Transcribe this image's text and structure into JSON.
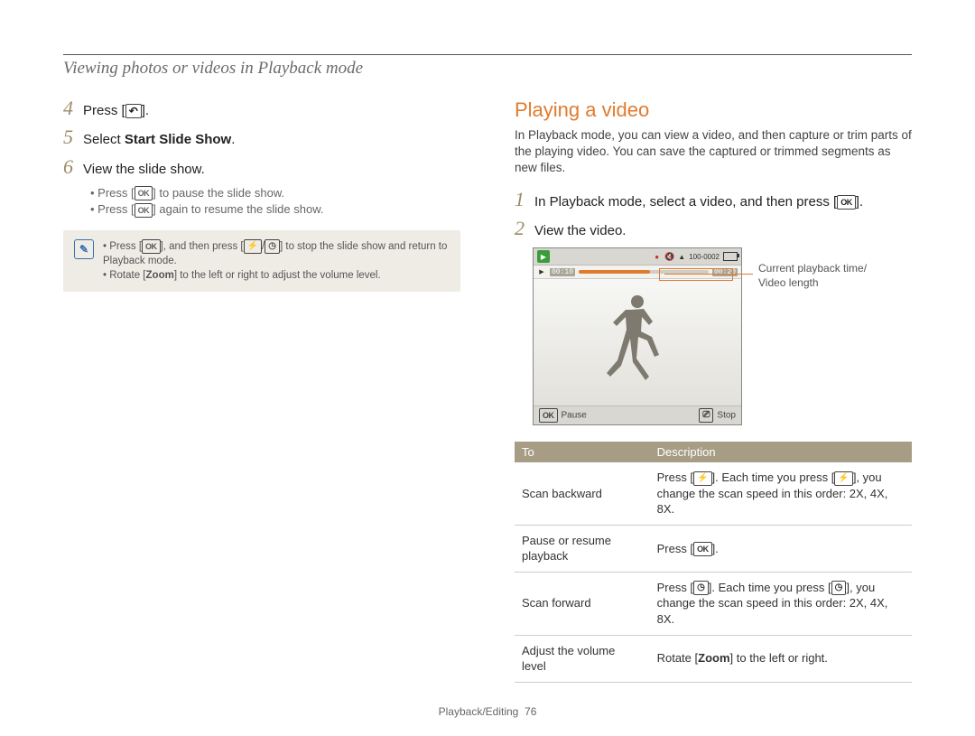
{
  "page_heading": "Viewing photos or videos in Playback mode",
  "left": {
    "steps": [
      {
        "num": "4",
        "pre": "Press [",
        "icon": "back",
        "post": "]."
      },
      {
        "num": "5",
        "pre": "Select ",
        "bold": "Start Slide Show",
        "post": "."
      },
      {
        "num": "6",
        "text": "View the slide show."
      }
    ],
    "subbullets": [
      {
        "pre": "Press [",
        "icon": "ok",
        "post": "] to pause the slide show."
      },
      {
        "pre": "Press [",
        "icon": "ok",
        "post": "] again to resume the slide show."
      }
    ],
    "note": [
      {
        "pre": "Press [",
        "icon": "ok",
        "mid": "], and then press [",
        "icon2": "flash",
        "sep": "/",
        "icon3": "timer",
        "post": "] to stop the slide show and return to Playback mode."
      },
      {
        "pre": "Rotate [",
        "bold": "Zoom",
        "post": "] to the left or right to adjust the volume level."
      }
    ]
  },
  "right": {
    "section_title": "Playing a video",
    "intro": "In Playback mode, you can view a video, and then capture or trim parts of the playing video. You can save the captured or trimmed segments as new files.",
    "steps": [
      {
        "num": "1",
        "pre": "In Playback mode, select a video, and then press [",
        "icon": "ok",
        "post": "]."
      },
      {
        "num": "2",
        "text": "View the video."
      }
    ],
    "screen": {
      "file_num": "100-0002",
      "time_current": "00:10",
      "time_total": "00:20",
      "pause": "Pause",
      "stop": "Stop"
    },
    "callout_l1": "Current playback time/",
    "callout_l2": "Video length",
    "table": {
      "th_to": "To",
      "th_desc": "Description",
      "rows": [
        {
          "to": "Scan backward",
          "desc_pre": "Press [",
          "desc_icon": "flash",
          "desc_mid": "]. Each time you press [",
          "desc_icon2": "flash",
          "desc_post": "], you change the scan speed in this order: 2X, 4X, 8X."
        },
        {
          "to": "Pause or resume playback",
          "desc_pre": "Press [",
          "desc_icon": "ok",
          "desc_post": "]."
        },
        {
          "to": "Scan forward",
          "desc_pre": "Press [",
          "desc_icon": "timer",
          "desc_mid": "]. Each time you press [",
          "desc_icon2": "timer",
          "desc_post": "], you change the scan speed in this order: 2X, 4X, 8X."
        },
        {
          "to": "Adjust the volume level",
          "desc_pre": "Rotate [",
          "desc_bold": "Zoom",
          "desc_post": "] to the left or right."
        }
      ]
    }
  },
  "footer_section": "Playback/Editing",
  "footer_page": "76",
  "icons": {
    "ok": "OK"
  }
}
